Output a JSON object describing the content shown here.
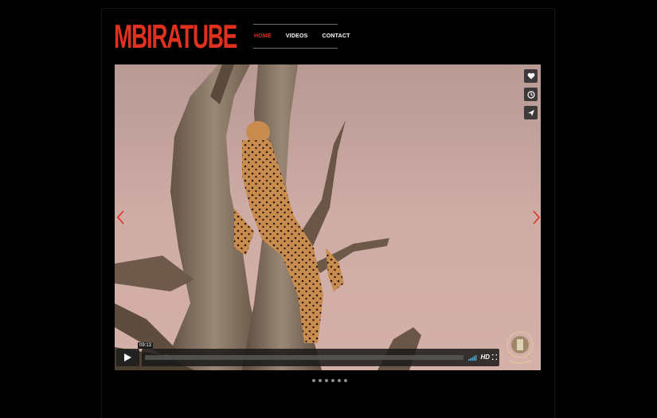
{
  "brand": {
    "logo_text": "MBIRATUBE",
    "logo_color": "#e0301e"
  },
  "nav": {
    "home": "HOME",
    "videos": "VIDEOS",
    "contact": "CONTACT",
    "active": "HOME",
    "active_color": "#e0301e"
  },
  "player": {
    "timecode": "09:13",
    "hd_label": "HD",
    "side_buttons": [
      "heart-icon",
      "clock-icon",
      "send-icon"
    ],
    "progress": 0
  },
  "slider": {
    "prev_icon": "chevron-left-icon",
    "next_icon": "chevron-right-icon",
    "dot_count": 6,
    "arrow_color": "#e0301e"
  }
}
